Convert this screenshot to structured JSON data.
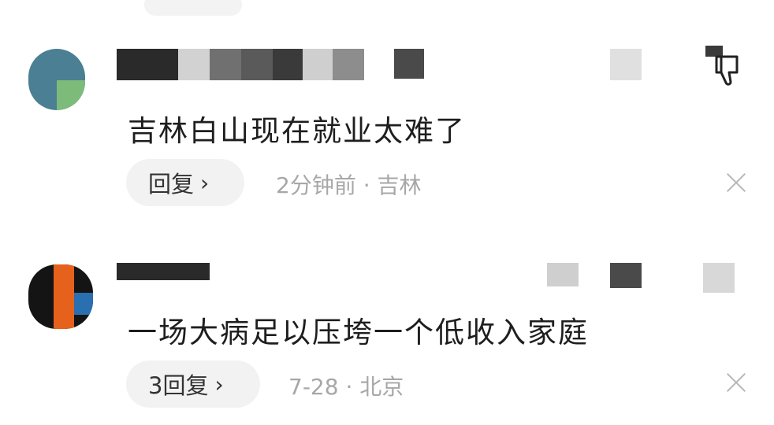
{
  "comments": [
    {
      "text": "吉林白山现在就业太难了",
      "reply_label": "回复",
      "reply_chevron": "›",
      "time": "2分钟前",
      "separator": "·",
      "location": "吉林",
      "icons": [
        "dislike-icon",
        "close-icon"
      ]
    },
    {
      "text": "一场大病足以压垮一个低收入家庭",
      "reply_label": "3回复",
      "reply_chevron": "›",
      "time": "7-28",
      "separator": "·",
      "location": "北京",
      "icons": [
        "close-icon"
      ]
    }
  ]
}
